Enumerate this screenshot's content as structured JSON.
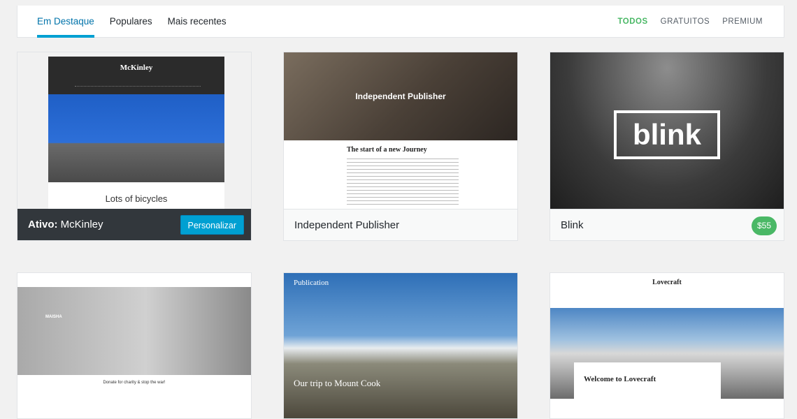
{
  "tabs": [
    {
      "label": "Em Destaque",
      "active": true
    },
    {
      "label": "Populares",
      "active": false
    },
    {
      "label": "Mais recentes",
      "active": false
    }
  ],
  "filters": [
    {
      "label": "TODOS",
      "active": true
    },
    {
      "label": "GRATUITOS",
      "active": false
    },
    {
      "label": "PREMIUM",
      "active": false
    }
  ],
  "themes": {
    "mckinley": {
      "active_prefix": "Ativo:",
      "name": "McKinley",
      "action_label": "Personalizar",
      "preview_title": "McKinley",
      "preview_caption": "Lots of bicycles"
    },
    "independent_publisher": {
      "name": "Independent Publisher",
      "preview_title": "Independent Publisher",
      "preview_heading": "The start of a new Journey"
    },
    "blink": {
      "name": "Blink",
      "price": "$55",
      "preview_logo": "blink"
    },
    "maisha": {
      "preview_brand": "MAISHA",
      "preview_heading": "Donate for charity & stop the war!"
    },
    "publication": {
      "preview_label": "Publication",
      "preview_title": "Our trip to Mount Cook"
    },
    "lovecraft": {
      "preview_title": "Lovecraft",
      "preview_heading": "Welcome to Lovecraft"
    }
  },
  "colors": {
    "accent_blue": "#00a0d2",
    "active_tab_text": "#0073aa",
    "price_green": "#4ab866",
    "active_bar": "#32373c"
  }
}
